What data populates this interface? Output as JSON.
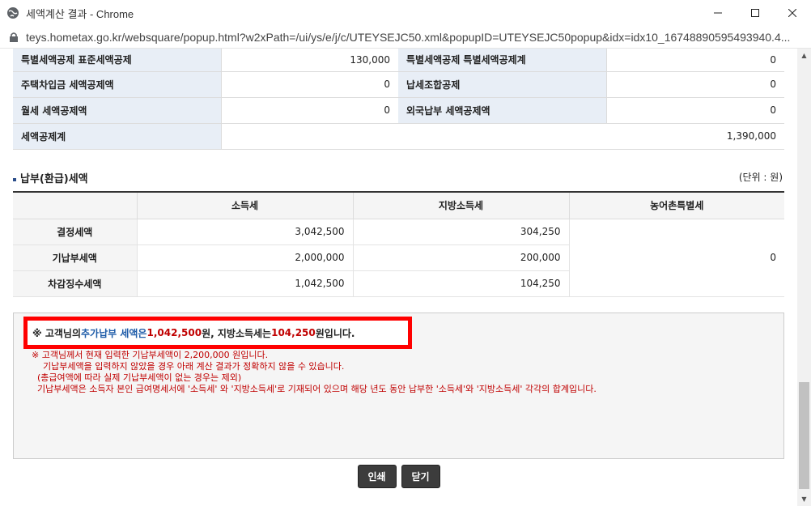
{
  "window": {
    "title": "세액계산 결과 - Chrome",
    "url": "teys.hometax.go.kr/websquare/popup.html?w2xPath=/ui/ys/e/j/c/UTEYSEJC50.xml&popupID=UTEYSEJC50popup&idx=idx10_16748890595493940.4..."
  },
  "deductions": {
    "row1": {
      "l1": "특별세액공제 표준세액공제",
      "v1": "130,000",
      "l2": "특별세액공제 특별세액공제계",
      "v2": "0"
    },
    "row2": {
      "l1": "주택차입금 세액공제액",
      "v1": "0",
      "l2": "납세조합공제",
      "v2": "0"
    },
    "row3": {
      "l1": "월세 세액공제액",
      "v1": "0",
      "l2": "외국납부 세액공제액",
      "v2": "0"
    },
    "row4": {
      "l1": "세액공제계",
      "v1": "1,390,000"
    }
  },
  "section": {
    "title": "납부(환급)세액",
    "unit": "(단위 : 원)"
  },
  "tax_table": {
    "headers": [
      "소득세",
      "지방소득세",
      "농어촌특별세"
    ],
    "rows": [
      {
        "label": "결정세액",
        "income": "3,042,500",
        "local": "304,250"
      },
      {
        "label": "기납부세액",
        "income": "2,000,000",
        "local": "200,000"
      },
      {
        "label": "차감징수세액",
        "income": "1,042,500",
        "local": "104,250"
      }
    ],
    "rural": "0"
  },
  "notice": {
    "p1": "※ 고객님의 ",
    "p2": "추가납부 세액은 ",
    "p3": "1,042,500",
    "p4": "원,  지방소득세는 ",
    "p5": "104,250",
    "p6": "원입니다.",
    "line1": "※ 고객님께서 현재 입력한 기납부세액이 2,200,000 원입니다.",
    "line2": "    기납부세액을 입력하지 않았을 경우 아래 계산 결과가 정확하지 않을 수 있습니다.",
    "line3": "  (총급여액에 따라 실제 기납부세액이 없는 경우는 제외)",
    "line4": "  기납부세액은 소득자 본인 급여명세서에 '소득세' 와 '지방소득세'로 기재되어 있으며 해당 년도 동안 납부한 '소득세'와 '지방소득세' 각각의 합계입니다."
  },
  "buttons": {
    "print": "인쇄",
    "close": "닫기"
  }
}
